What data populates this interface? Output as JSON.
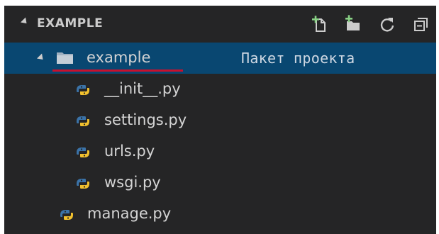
{
  "explorer": {
    "section_title": "EXAMPLE",
    "actions": [
      {
        "name": "new-file-icon"
      },
      {
        "name": "new-folder-icon"
      },
      {
        "name": "refresh-icon"
      },
      {
        "name": "collapse-all-icon"
      }
    ]
  },
  "tree": {
    "folder": {
      "label": "example",
      "description": "Пакет проекта",
      "icon": "folder-icon",
      "expanded": true
    },
    "files": [
      {
        "label": "__init__.py",
        "icon": "python-file-icon"
      },
      {
        "label": "settings.py",
        "icon": "python-file-icon"
      },
      {
        "label": "urls.py",
        "icon": "python-file-icon"
      },
      {
        "label": "wsgi.py",
        "icon": "python-file-icon"
      }
    ],
    "root_file": {
      "label": "manage.py",
      "icon": "python-file-icon"
    }
  },
  "colors": {
    "background": "#252526",
    "selection": "#094771",
    "annotation_underline": "#c8102e",
    "python_blue": "#3b73a8",
    "python_yellow": "#f2c12e"
  }
}
